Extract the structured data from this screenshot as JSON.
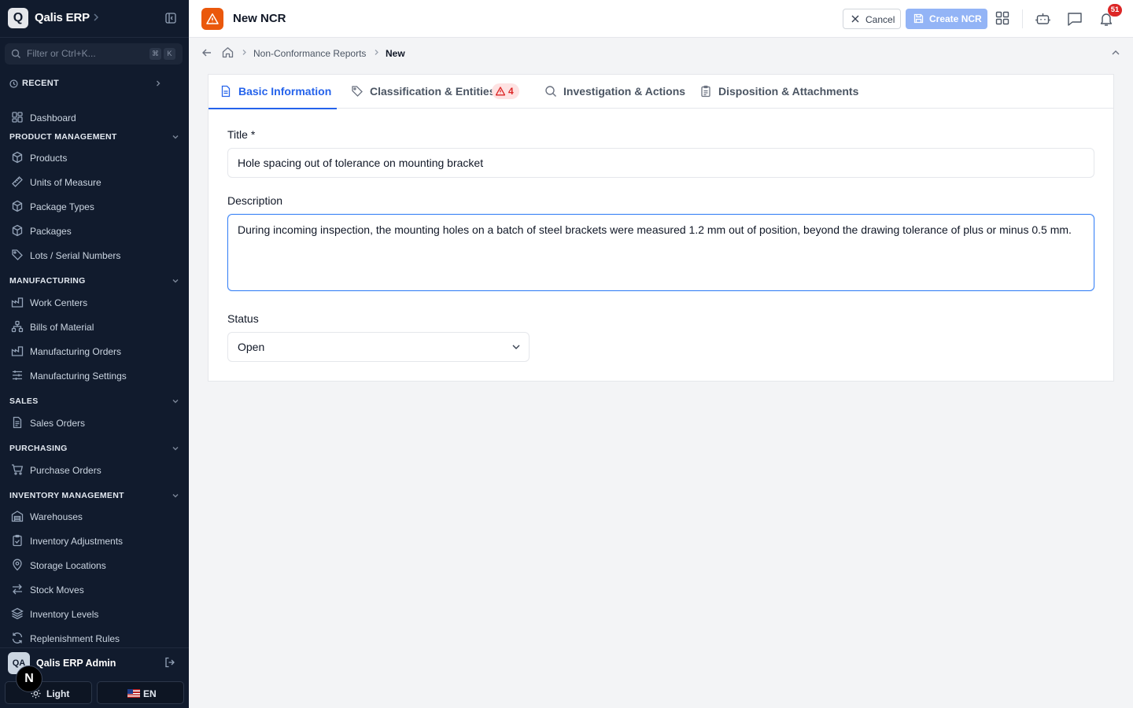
{
  "app": {
    "brand": "Qalis ERP",
    "logo_letter": "Q"
  },
  "sidebar": {
    "filter_placeholder": "Filter or Ctrl+K...",
    "shortcut_keys": [
      "⌘",
      "K"
    ],
    "recent_label": "RECENT",
    "dashboard_label": "Dashboard",
    "sections": [
      {
        "label": "PRODUCT MANAGEMENT",
        "items": [
          "Products",
          "Units of Measure",
          "Package Types",
          "Packages",
          "Lots / Serial Numbers"
        ]
      },
      {
        "label": "MANUFACTURING",
        "items": [
          "Work Centers",
          "Bills of Material",
          "Manufacturing Orders",
          "Manufacturing Settings"
        ]
      },
      {
        "label": "SALES",
        "items": [
          "Sales Orders"
        ]
      },
      {
        "label": "PURCHASING",
        "items": [
          "Purchase Orders"
        ]
      },
      {
        "label": "INVENTORY MANAGEMENT",
        "items": [
          "Warehouses",
          "Inventory Adjustments",
          "Storage Locations",
          "Stock Moves",
          "Inventory Levels",
          "Replenishment Rules"
        ]
      }
    ],
    "user": {
      "initials": "QA",
      "name": "Qalis ERP Admin"
    },
    "n_badge": "N",
    "theme_label": "Light",
    "lang_label": "EN"
  },
  "topbar": {
    "title": "New NCR",
    "cancel_label": "Cancel",
    "create_label": "Create NCR",
    "notification_count": "51"
  },
  "breadcrumb": {
    "parent": "Non-Conformance Reports",
    "current": "New"
  },
  "tabs": [
    {
      "label": "Basic Information",
      "active": true
    },
    {
      "label": "Classification & Entities",
      "warning_count": "4"
    },
    {
      "label": "Investigation & Actions"
    },
    {
      "label": "Disposition & Attachments"
    }
  ],
  "form": {
    "title_label": "Title *",
    "title_value": "Hole spacing out of tolerance on mounting bracket",
    "description_label": "Description",
    "description_value": "During incoming inspection, the mounting holes on a batch of steel brackets were measured 1.2 mm out of position, beyond the drawing tolerance of plus or minus 0.5 mm.",
    "status_label": "Status",
    "status_value": "Open"
  },
  "colors": {
    "sidebar_bg": "#111b2d",
    "accent": "#2563eb",
    "page_icon": "#ea580c",
    "danger": "#dc2626"
  }
}
